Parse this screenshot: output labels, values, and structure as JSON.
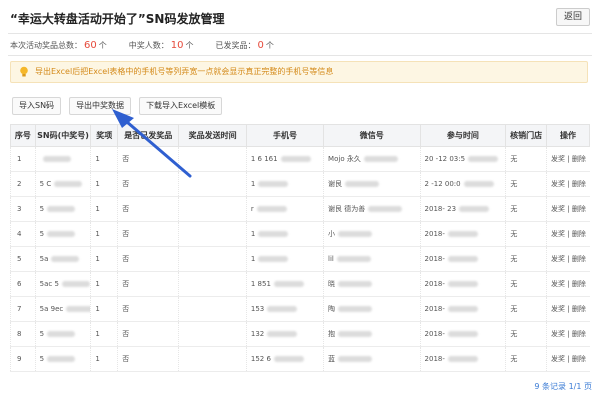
{
  "header": {
    "title": "“幸运大转盘活动开始了”SN码发放管理",
    "back_label": "返回"
  },
  "stats": {
    "total_label": "本次活动奖品总数：",
    "total_value": "60",
    "total_unit": "个",
    "winners_label": "中奖人数：",
    "winners_value": "10",
    "winners_unit": "个",
    "sent_label": "已发奖品：",
    "sent_value": "0",
    "sent_unit": "个"
  },
  "notice": {
    "text": "导出Excel后把Excel表格中的手机号等列弄宽一点就会显示真正完整的手机号等信息",
    "icon": "lightbulb-icon"
  },
  "toolbar": {
    "import_sn": "导入SN码",
    "export_winners": "导出中奖数据",
    "download_template": "下载导入Excel模板"
  },
  "table": {
    "headers": [
      "序号",
      "SN码(中奖号)",
      "奖项",
      "是否已发奖品",
      "奖品发送时间",
      "手机号",
      "微信号",
      "参与时间",
      "核销门店",
      "操作"
    ],
    "rows": [
      {
        "no": "1",
        "sn": "",
        "prize": "1",
        "sent": "否",
        "phone": "1 6 161",
        "wechat": "Mojo 永久",
        "time": "20 -12 03:5",
        "store": "无"
      },
      {
        "no": "2",
        "sn": "5 C",
        "prize": "1",
        "sent": "否",
        "phone": "1",
        "wechat": "谢艮",
        "time": "2 -12 00:0",
        "store": "无"
      },
      {
        "no": "3",
        "sn": "5",
        "prize": "1",
        "sent": "否",
        "phone": "r",
        "wechat": "谢艮 德为善",
        "time": "2018- 23",
        "store": "无"
      },
      {
        "no": "4",
        "sn": "5",
        "prize": "1",
        "sent": "否",
        "phone": "1",
        "wechat": "小",
        "time": "2018-",
        "store": "无"
      },
      {
        "no": "5",
        "sn": "5a",
        "prize": "1",
        "sent": "否",
        "phone": "1",
        "wechat": "lil",
        "time": "2018-",
        "store": "无"
      },
      {
        "no": "6",
        "sn": "5ac 5",
        "prize": "1",
        "sent": "否",
        "phone": "1 851",
        "wechat": "晓",
        "time": "2018-",
        "store": "无"
      },
      {
        "no": "7",
        "sn": "5a 9ec",
        "prize": "1",
        "sent": "否",
        "phone": "153",
        "wechat": "陶",
        "time": "2018-",
        "store": "无"
      },
      {
        "no": "8",
        "sn": "5",
        "prize": "1",
        "sent": "否",
        "phone": "132",
        "wechat": "抱",
        "time": "2018-",
        "store": "无"
      },
      {
        "no": "9",
        "sn": "5",
        "prize": "1",
        "sent": "否",
        "phone": "152 6",
        "wechat": "蓝",
        "time": "2018-",
        "store": "无"
      }
    ],
    "op_send": "发奖",
    "op_sep": "|",
    "op_delete": "删除"
  },
  "pager": {
    "text": "9 条记录 1/1 页"
  },
  "colors": {
    "accent_red": "#e64a3b",
    "notice_text": "#d48a1a",
    "arrow": "#2f5fd0",
    "link": "#3a7bd5"
  }
}
